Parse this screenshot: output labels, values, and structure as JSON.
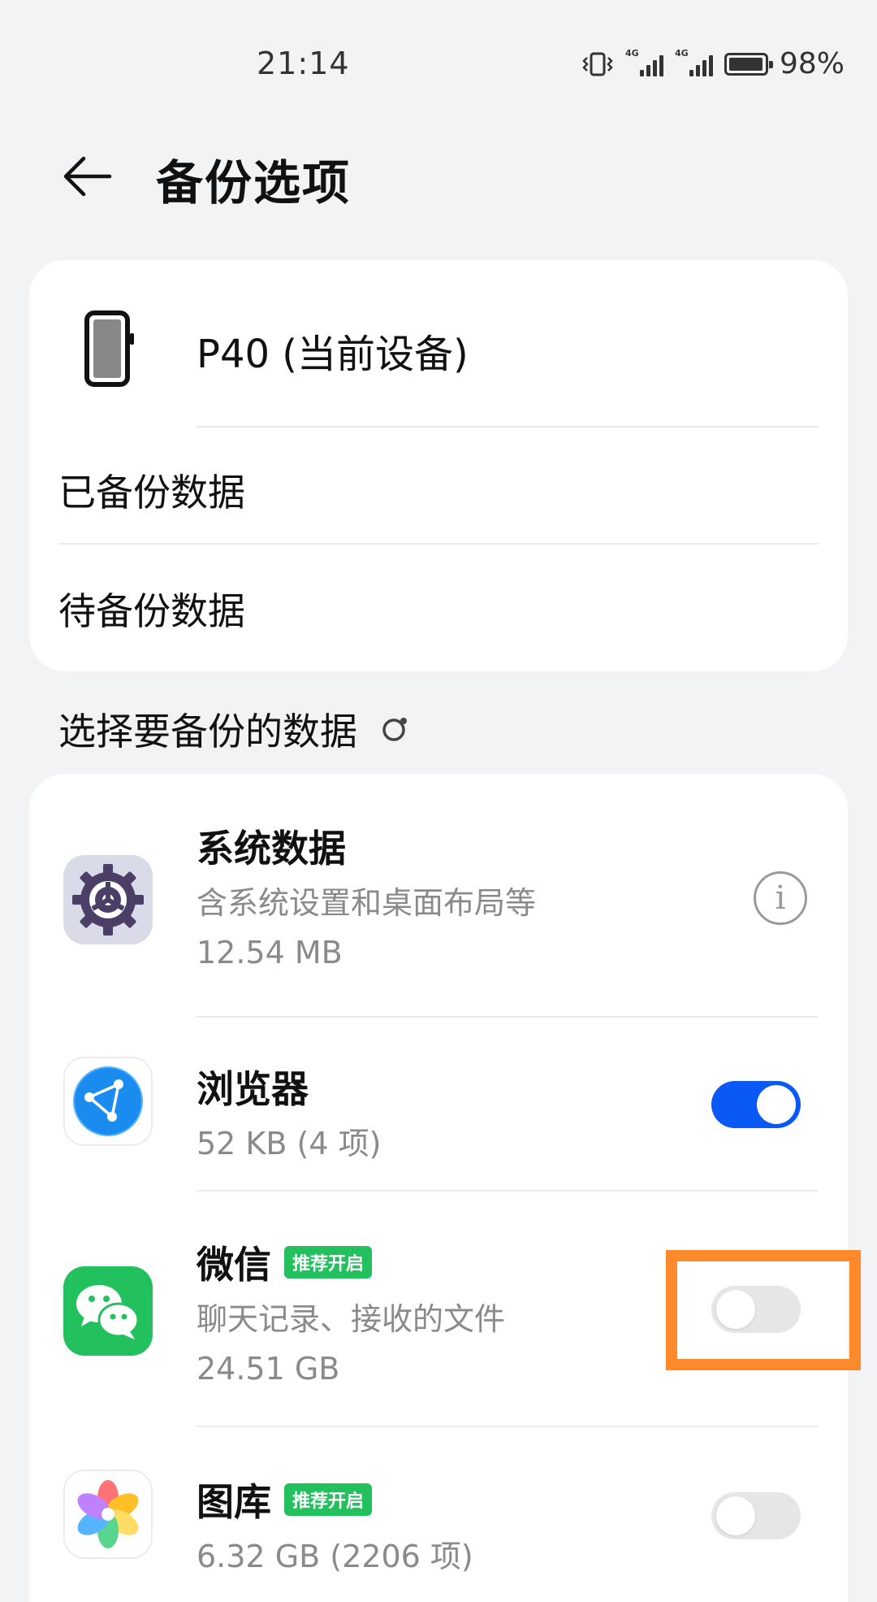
{
  "status_bar": {
    "time": "21:14",
    "battery_percent": "98%",
    "signal_1_label": "4G",
    "signal_2_label": "4G",
    "battery_level": 0.98,
    "icons": [
      "vibrate-icon",
      "signal-4g-icon",
      "signal-4g-icon",
      "battery-icon"
    ]
  },
  "header": {
    "title": "备份选项",
    "back_icon": "back-arrow-icon"
  },
  "device_card": {
    "device_name": "P40 (当前设备)",
    "device_icon": "phone-icon",
    "rows": [
      {
        "label": "已备份数据"
      },
      {
        "label": "待备份数据"
      }
    ]
  },
  "section": {
    "title": "选择要备份的数据",
    "loading_icon": "spinner-icon"
  },
  "apps": [
    {
      "name": "系统数据",
      "description": "含系统设置和桌面布局等",
      "size": "12.54 MB",
      "icon": "system-settings-gear-icon",
      "action": "info"
    },
    {
      "name": "浏览器",
      "size": "52 KB (4 项)",
      "icon": "browser-globe-icon",
      "toggle_on": true
    },
    {
      "name": "微信",
      "badge": "推荐开启",
      "description": "聊天记录、接收的文件",
      "size": "24.51 GB",
      "icon": "wechat-icon",
      "toggle_on": false
    },
    {
      "name": "图库",
      "badge": "推荐开启",
      "size": "6.32 GB (2206 项)",
      "icon": "gallery-flower-icon",
      "toggle_on": false
    }
  ],
  "colors": {
    "background": "#f1f3f5",
    "accent": "#0a59f7",
    "badge_green": "#22c15e",
    "highlight_orange": "#ff8a2b"
  }
}
